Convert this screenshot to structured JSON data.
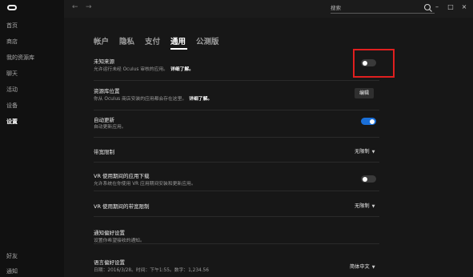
{
  "sidebar": {
    "items": [
      {
        "label": "首页"
      },
      {
        "label": "商店"
      },
      {
        "label": "我的资源库"
      },
      {
        "label": "聊天"
      },
      {
        "label": "活动"
      },
      {
        "label": "设备"
      },
      {
        "label": "设置"
      }
    ],
    "bottom_items": [
      {
        "label": "好友"
      },
      {
        "label": "通知"
      }
    ]
  },
  "topbar": {
    "back_icon": "←",
    "forward_icon": "→",
    "search_placeholder": "搜索",
    "minimize": "–",
    "maximize": "□",
    "close": "×"
  },
  "tabs": [
    {
      "label": "帐户"
    },
    {
      "label": "隐私"
    },
    {
      "label": "支付"
    },
    {
      "label": "通用"
    },
    {
      "label": "公测版"
    }
  ],
  "settings": {
    "unknown_sources": {
      "title": "未知来源",
      "desc": "允许运行未经 Oculus 审核的应用。",
      "link": "详细了解。",
      "state": "off"
    },
    "library_location": {
      "title": "资源库位置",
      "desc": "你从 Oculus 商店安装的应用都会存在这里。",
      "link": "详细了解。",
      "button": "编辑"
    },
    "auto_update": {
      "title": "自动更新",
      "desc": "自动更新应用。",
      "state": "on"
    },
    "bandwidth_limit": {
      "title": "带宽限制",
      "value": "无限制"
    },
    "vr_downloads": {
      "title": "VR 使用期间的应用下载",
      "desc": "允许系统在你使用 VR 应用期间安装和更新应用。",
      "state": "off"
    },
    "vr_bandwidth": {
      "title": "VR 使用期间的带宽限制",
      "value": "无限制"
    },
    "notifications": {
      "title": "通知偏好设置",
      "desc": "设置你希望接收的通知。"
    },
    "language": {
      "title": "语言偏好设置",
      "desc": "日期：2016/3/28。时间：下午1:55。数字：1,234.56",
      "value": "简体中文"
    }
  },
  "colors": {
    "accent": "#1a6fd8",
    "highlight": "#e01f1f"
  }
}
